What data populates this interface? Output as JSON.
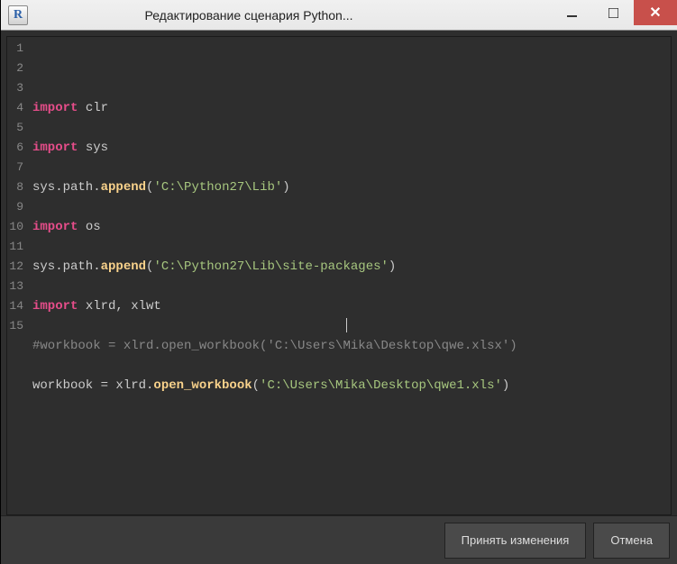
{
  "window": {
    "app_icon_letter": "R",
    "title": "Редактирование сценария Python..."
  },
  "code": {
    "lines": [
      {
        "n": 1,
        "tokens": [
          {
            "t": "import",
            "c": "kw"
          },
          {
            "t": " clr",
            "c": ""
          }
        ]
      },
      {
        "n": 2,
        "tokens": []
      },
      {
        "n": 3,
        "tokens": [
          {
            "t": "import",
            "c": "kw"
          },
          {
            "t": " sys",
            "c": ""
          }
        ]
      },
      {
        "n": 4,
        "tokens": []
      },
      {
        "n": 5,
        "tokens": [
          {
            "t": "sys.path.",
            "c": ""
          },
          {
            "t": "append",
            "c": "fn"
          },
          {
            "t": "(",
            "c": ""
          },
          {
            "t": "'C:\\Python27\\Lib'",
            "c": "str"
          },
          {
            "t": ")",
            "c": ""
          }
        ]
      },
      {
        "n": 6,
        "tokens": []
      },
      {
        "n": 7,
        "tokens": [
          {
            "t": "import",
            "c": "kw"
          },
          {
            "t": " os",
            "c": ""
          }
        ]
      },
      {
        "n": 8,
        "tokens": []
      },
      {
        "n": 9,
        "tokens": [
          {
            "t": "sys.path.",
            "c": ""
          },
          {
            "t": "append",
            "c": "fn"
          },
          {
            "t": "(",
            "c": ""
          },
          {
            "t": "'C:\\Python27\\Lib\\site-packages'",
            "c": "str"
          },
          {
            "t": ")",
            "c": ""
          }
        ]
      },
      {
        "n": 10,
        "tokens": []
      },
      {
        "n": 11,
        "tokens": [
          {
            "t": "import",
            "c": "kw"
          },
          {
            "t": " xlrd, xlwt",
            "c": ""
          }
        ]
      },
      {
        "n": 12,
        "tokens": []
      },
      {
        "n": 13,
        "tokens": [
          {
            "t": "#workbook = xlrd.open_workbook('C:\\Users\\Mika\\Desktop\\qwe.xlsx')",
            "c": "cmt"
          }
        ]
      },
      {
        "n": 14,
        "tokens": []
      },
      {
        "n": 15,
        "tokens": [
          {
            "t": "workbook = xlrd.",
            "c": ""
          },
          {
            "t": "open_workbook",
            "c": "fn"
          },
          {
            "t": "(",
            "c": ""
          },
          {
            "t": "'C:\\Users\\Mika\\Desktop\\qwe1.xls'",
            "c": "str"
          },
          {
            "t": ")",
            "c": ""
          }
        ]
      }
    ]
  },
  "buttons": {
    "accept": "Принять изменения",
    "cancel": "Отмена"
  }
}
